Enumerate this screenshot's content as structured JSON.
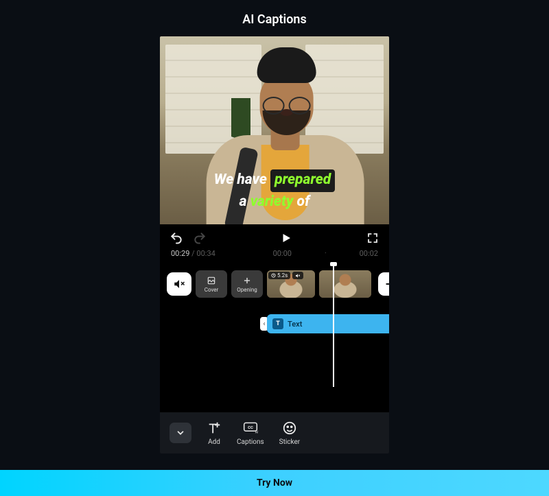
{
  "header": {
    "title": "AI Captions"
  },
  "preview": {
    "caption": {
      "line1_pre": "We have ",
      "line1_hl": "prepared",
      "line2_pre": "a ",
      "line2_hl": "variety",
      "line2_post": " of"
    }
  },
  "controls": {
    "undo": "undo",
    "redo": "redo",
    "play": "play",
    "fullscreen": "fullscreen"
  },
  "time": {
    "current": "00:29",
    "total": "00:34",
    "mark1": "00:00",
    "mark2": "00:02"
  },
  "timeline": {
    "mute": "mute",
    "cover_label": "Cover",
    "opening_label": "Opening",
    "clip_duration": "5.2s",
    "add": "add",
    "text_label": "Text"
  },
  "toolbar": {
    "collapse": "collapse",
    "add": "Add",
    "captions": "Captions",
    "sticker": "Sticker"
  },
  "cta": {
    "label": "Try Now"
  }
}
